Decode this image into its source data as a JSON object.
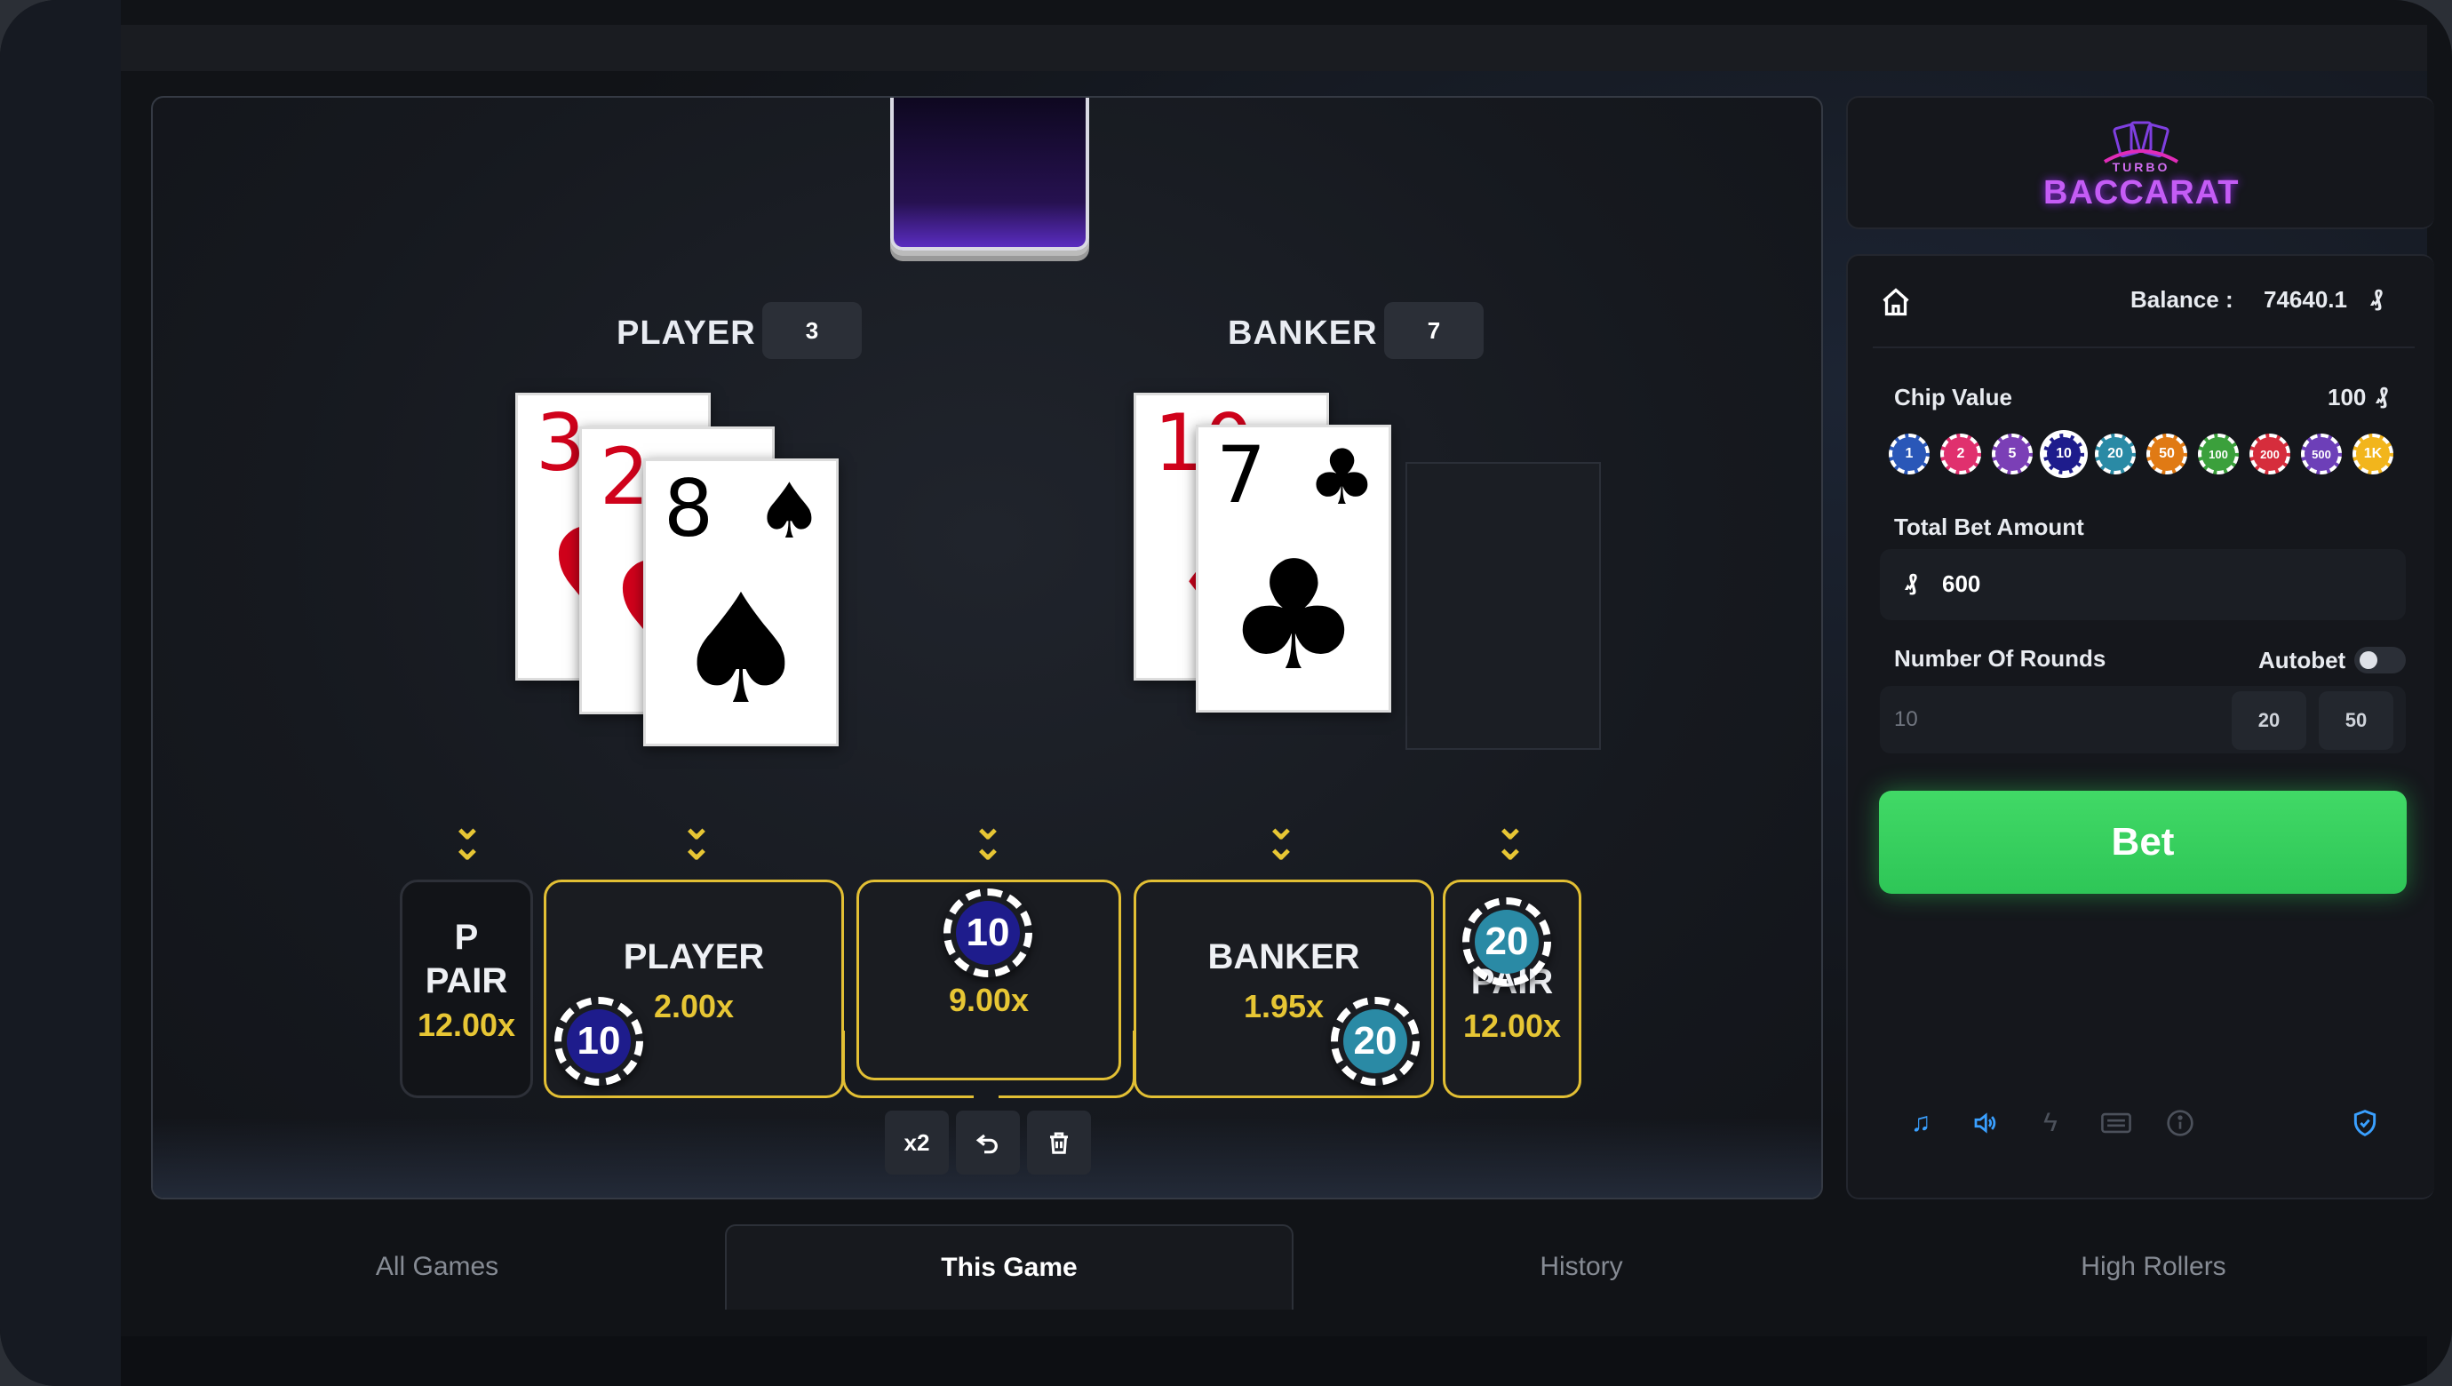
{
  "logo": {
    "top": "TURBO",
    "main": "BACCARAT"
  },
  "hands": {
    "player": {
      "label": "PLAYER",
      "score": "3"
    },
    "banker": {
      "label": "BANKER",
      "score": "7"
    }
  },
  "player_cards": [
    {
      "rank": "3",
      "suit": "♥",
      "color": "red"
    },
    {
      "rank": "2",
      "suit": "♥",
      "color": "red"
    },
    {
      "rank": "8",
      "suit": "♠",
      "color": "black"
    }
  ],
  "banker_cards": [
    {
      "rank": "10",
      "suit": "♦",
      "color": "red"
    },
    {
      "rank": "7",
      "suit": "♣",
      "color": "black"
    }
  ],
  "bets": {
    "p_pair": {
      "line1": "P",
      "line2": "PAIR",
      "mult": "12.00x"
    },
    "player": {
      "name": "PLAYER",
      "mult": "2.00x",
      "chip": "10"
    },
    "tie": {
      "mult": "9.00x",
      "chip": "10"
    },
    "banker": {
      "name": "BANKER",
      "mult": "1.95x",
      "chip": "20"
    },
    "b_pair": {
      "line2": "PAIR",
      "mult": "12.00x",
      "chip": "20"
    }
  },
  "tools": {
    "double": "x2",
    "undo_icon": "undo-icon",
    "clear_icon": "trash-icon"
  },
  "panel": {
    "balance_label": "Balance :",
    "balance_value": "74640.1",
    "currency_symbol": "₰",
    "chip_value_label": "Chip Value",
    "chip_value": "100",
    "chips": [
      {
        "label": "1",
        "color": "#2a57b8"
      },
      {
        "label": "2",
        "color": "#e0306e"
      },
      {
        "label": "5",
        "color": "#7b3fb6"
      },
      {
        "label": "10",
        "color": "#1e1c8c"
      },
      {
        "label": "20",
        "color": "#2a8aa5"
      },
      {
        "label": "50",
        "color": "#e07a14"
      },
      {
        "label": "100",
        "color": "#3ba03c"
      },
      {
        "label": "200",
        "color": "#d62d3c"
      },
      {
        "label": "500",
        "color": "#6d3fb8"
      },
      {
        "label": "1K",
        "color": "#f2b51c"
      }
    ],
    "total_bet_label": "Total Bet Amount",
    "total_bet_value": "600",
    "rounds_label": "Number Of Rounds",
    "autobet_label": "Autobet",
    "rounds_value": "10",
    "rounds_options": [
      "20",
      "50"
    ],
    "bet_button": "Bet"
  },
  "tabs": [
    "All Games",
    "This Game",
    "History",
    "High Rollers"
  ],
  "colors": {
    "accent_gold": "#e2bf34",
    "bet_green": "#36cc5c",
    "chip_blue": "#1e1c8c",
    "chip_teal": "#2a8aa5"
  }
}
